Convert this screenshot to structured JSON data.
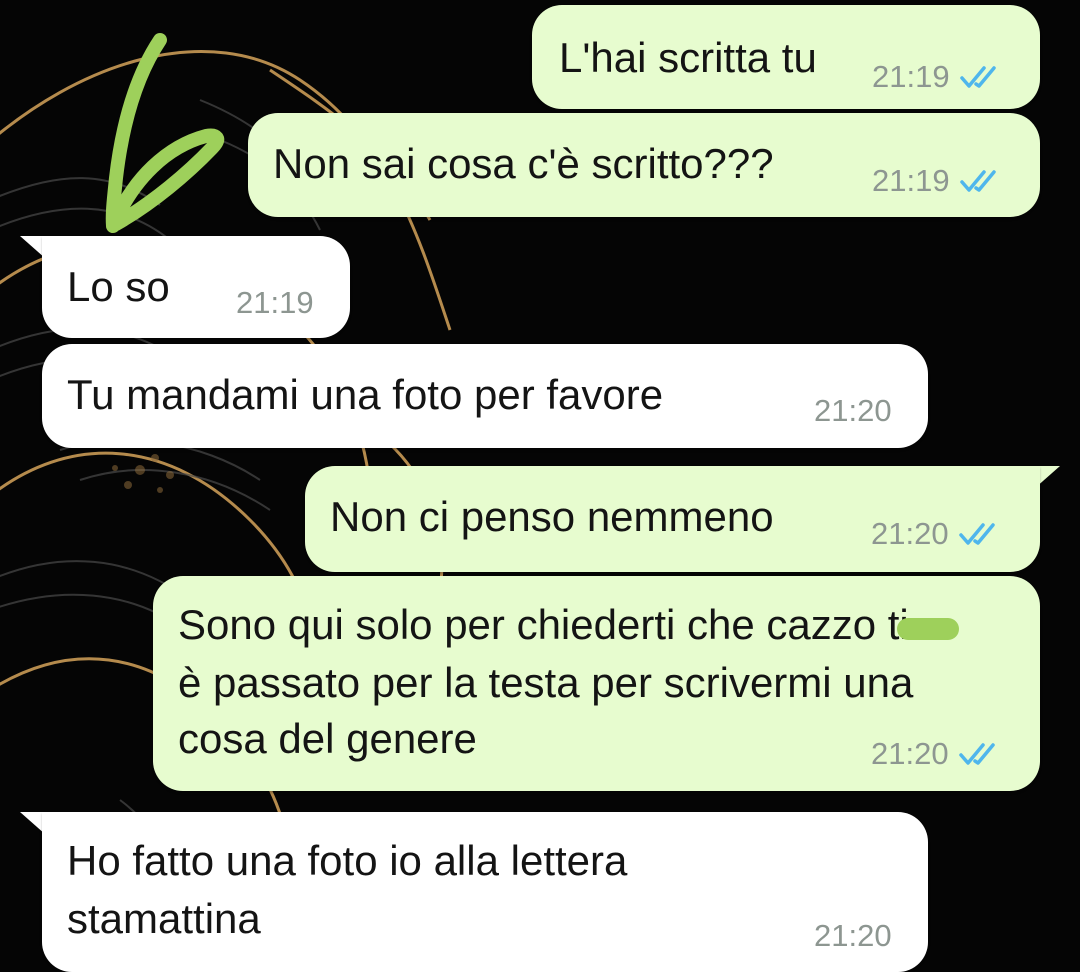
{
  "messages": [
    {
      "id": 1,
      "direction": "outgoing",
      "text": "L'hai scritta tu",
      "time": "21:19",
      "status": "read"
    },
    {
      "id": 2,
      "direction": "outgoing",
      "text": "Non sai cosa c'è scritto???",
      "time": "21:19",
      "status": "read"
    },
    {
      "id": 3,
      "direction": "incoming",
      "text": "Lo so",
      "time": "21:19"
    },
    {
      "id": 4,
      "direction": "incoming",
      "text": "Tu mandami una foto per favore",
      "time": "21:20"
    },
    {
      "id": 5,
      "direction": "outgoing",
      "text": "Non ci penso nemmeno",
      "time": "21:20",
      "status": "read"
    },
    {
      "id": 6,
      "direction": "outgoing",
      "lines": [
        "Sono qui solo per chiederti che cazzo ti",
        "è passato per la testa per scrivermi una",
        "cosa del genere"
      ],
      "time": "21:20",
      "status": "read"
    },
    {
      "id": 7,
      "direction": "incoming",
      "lines": [
        "Ho fatto una foto io alla lettera",
        "stamattina"
      ],
      "time": "21:20"
    }
  ],
  "colors": {
    "outgoing_bubble": "#e7fccf",
    "incoming_bubble": "#ffffff",
    "read_ticks": "#4fb6ec",
    "timestamp": "#8d9691",
    "annotation": "#9ed05b",
    "wallpaper": "#050505",
    "wallpaper_lines": "#c99a55"
  },
  "icons": {
    "read_receipt": "double-check-icon",
    "annotation": "handwritten-b-annotation"
  }
}
